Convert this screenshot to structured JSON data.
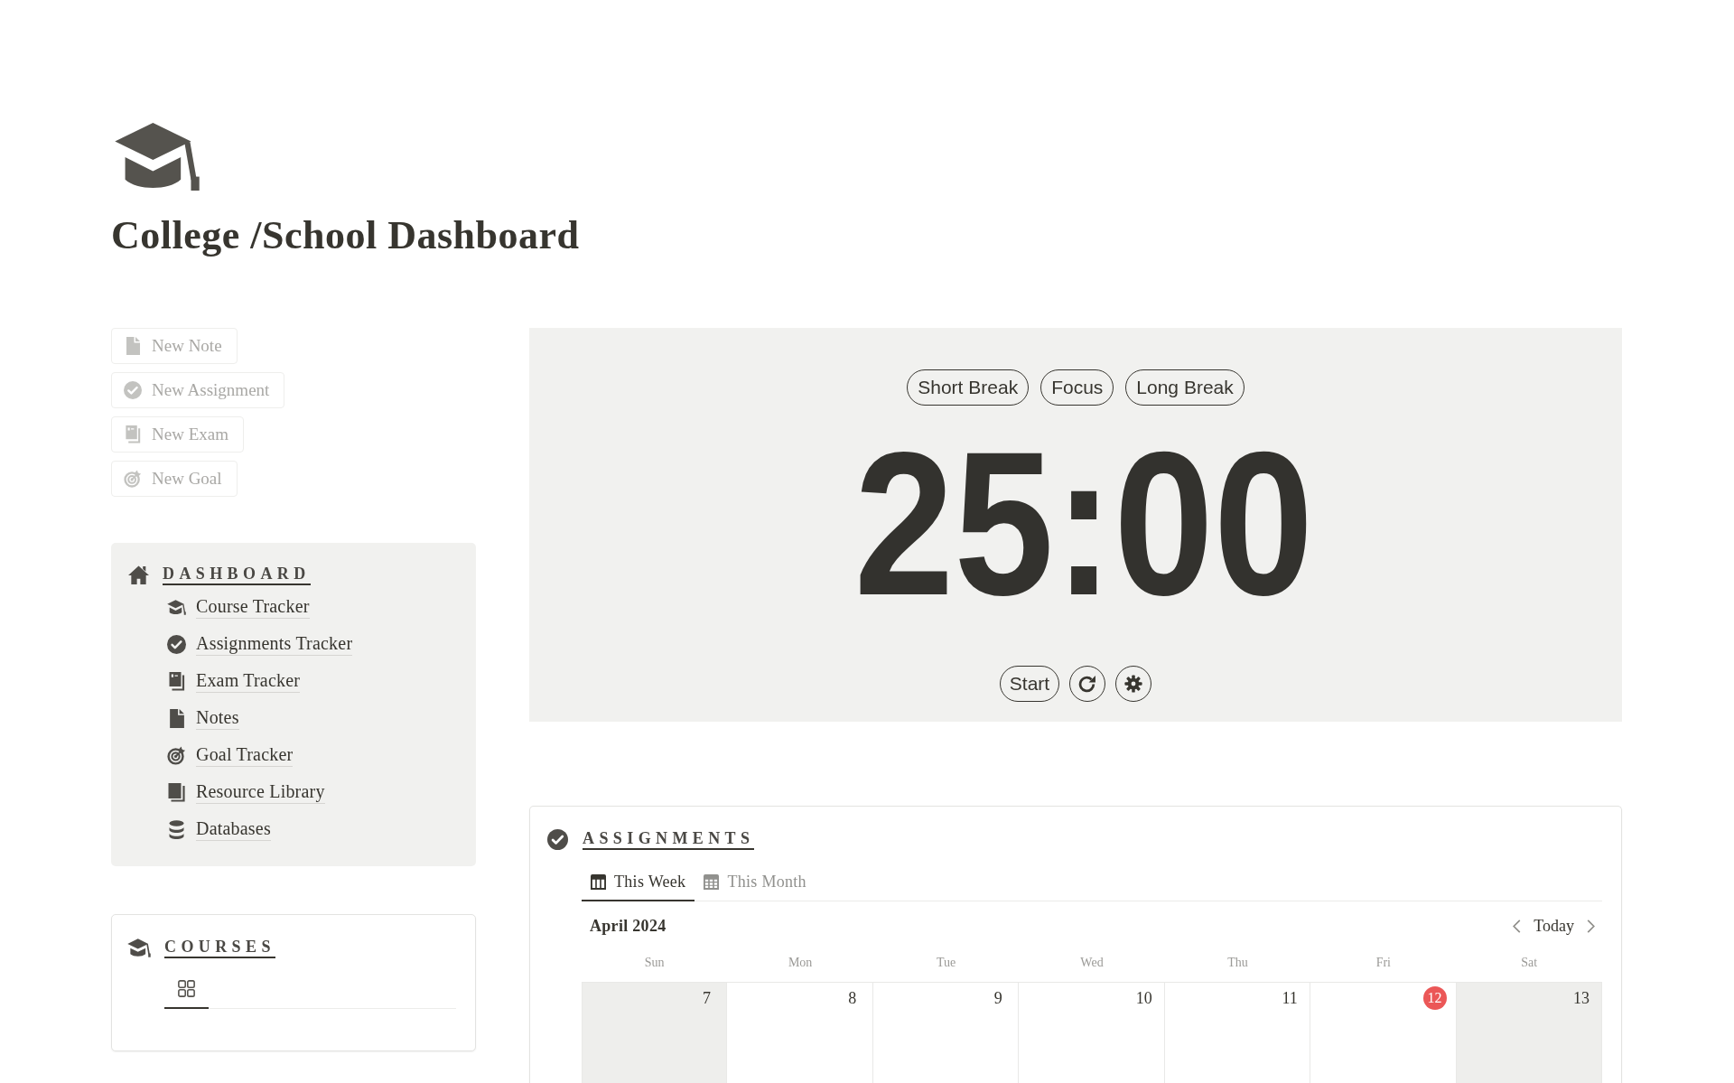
{
  "page": {
    "title": "College /School Dashboard"
  },
  "quick_actions": [
    {
      "label": "New Note",
      "kind": "note"
    },
    {
      "label": "New Assignment",
      "kind": "assignment"
    },
    {
      "label": "New Exam",
      "kind": "exam"
    },
    {
      "label": "New Goal",
      "kind": "goal"
    }
  ],
  "dashboard": {
    "heading": "DASHBOARD",
    "links": [
      {
        "label": "Course Tracker",
        "kind": "course"
      },
      {
        "label": "Assignments Tracker",
        "kind": "assignment"
      },
      {
        "label": "Exam Tracker",
        "kind": "exam"
      },
      {
        "label": "Notes",
        "kind": "note"
      },
      {
        "label": "Goal Tracker",
        "kind": "goal"
      },
      {
        "label": "Resource Library",
        "kind": "library"
      },
      {
        "label": "Databases",
        "kind": "database"
      }
    ]
  },
  "courses": {
    "heading": "COURSES",
    "views": [
      {
        "selected": true
      }
    ]
  },
  "timer": {
    "modes": [
      "Short Break",
      "Focus",
      "Long Break"
    ],
    "time": "25:00",
    "start_label": "Start"
  },
  "assignments": {
    "heading": "ASSIGNMENTS",
    "views": [
      {
        "label": "This Week",
        "kind": "week",
        "selected": true
      },
      {
        "label": "This Month",
        "kind": "month",
        "selected": false
      }
    ],
    "calendar": {
      "month": "April 2024",
      "today_label": "Today",
      "weekdays": [
        "Sun",
        "Mon",
        "Tue",
        "Wed",
        "Thu",
        "Fri",
        "Sat"
      ],
      "days": [
        {
          "date": "7",
          "weekend": true,
          "today": false
        },
        {
          "date": "8",
          "weekend": false,
          "today": false
        },
        {
          "date": "9",
          "weekend": false,
          "today": false
        },
        {
          "date": "10",
          "weekend": false,
          "today": false
        },
        {
          "date": "11",
          "weekend": false,
          "today": false
        },
        {
          "date": "12",
          "weekend": false,
          "today": true
        },
        {
          "date": "13",
          "weekend": true,
          "today": false
        }
      ]
    }
  }
}
